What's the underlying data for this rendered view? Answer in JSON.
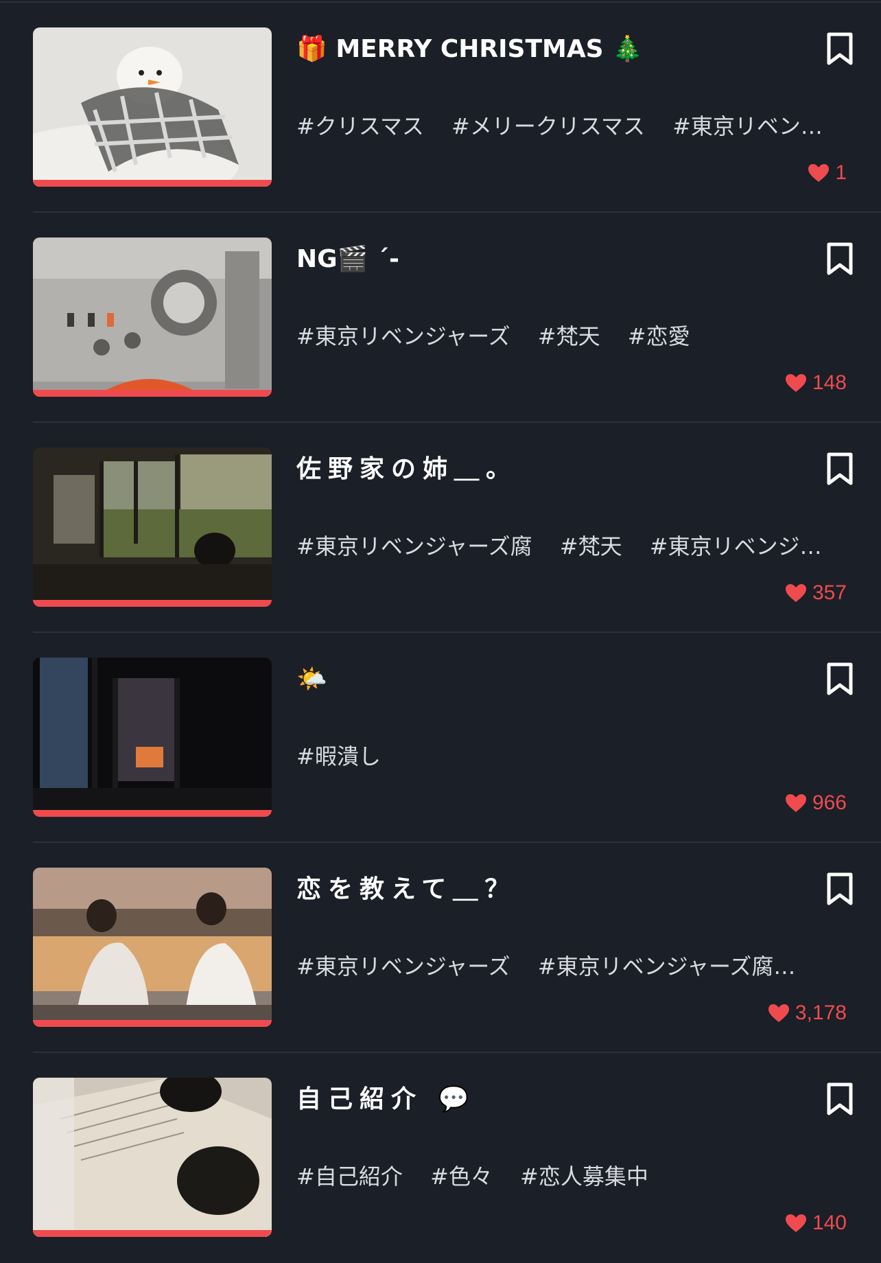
{
  "colors": {
    "background": "#1b1f27",
    "divider": "#2c313b",
    "accent": "#ef4b4f",
    "title": "#ffffff",
    "tag": "#d9dbe0"
  },
  "posts": [
    {
      "title": "🎁 MERRY CHRISTMAS 🎄",
      "tags": [
        "#クリスマス",
        "#メリークリスマス",
        "#東京リベン…"
      ],
      "likes": "1",
      "thumbnail": "snowman-photo"
    },
    {
      "title": "NG🎬 ´-",
      "tags": [
        "#東京リベンジャーズ",
        "#梵天",
        "#恋愛"
      ],
      "likes": "148",
      "thumbnail": "stereo-photo"
    },
    {
      "title": "佐野家の姉＿。",
      "tags": [
        "#東京リベンジャーズ腐",
        "#梵天",
        "#東京リベンジ…"
      ],
      "likes": "357",
      "thumbnail": "train-window-photo"
    },
    {
      "title": "🌤️",
      "tags": [
        "#暇潰し"
      ],
      "likes": "966",
      "thumbnail": "dark-window-photo"
    },
    {
      "title": "恋を教えて＿？",
      "tags": [
        "#東京リベンジャーズ",
        "#東京リベンジャーズ腐…"
      ],
      "likes": "3,178",
      "thumbnail": "couple-river-photo"
    },
    {
      "title": "自己紹介 💬",
      "tags": [
        "#自己紹介",
        "#色々",
        "#恋人募集中"
      ],
      "likes": "140",
      "thumbnail": "book-headphones-photo"
    }
  ]
}
